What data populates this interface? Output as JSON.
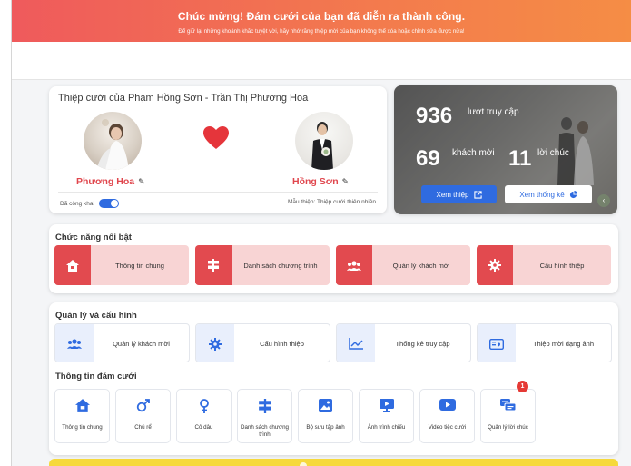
{
  "banner": {
    "title": "Chúc mừng! Đám cưới của bạn đã diễn ra thành công.",
    "subtitle": "Để giữ lại những khoảnh khắc tuyệt vời, hãy nhớ rằng thiệp mời của bạn không thể xóa hoặc chỉnh sửa được nữa!"
  },
  "profile": {
    "title": "Thiệp cưới của Phạm Hồng Sơn - Trần Thị Phương Hoa",
    "bride_name": "Phương Hoa",
    "groom_name": "Hồng Sơn",
    "published_label": "Đã công khai",
    "published": true,
    "template_label": "Mẫu thiệp: Thiệp cưới thiên nhiên"
  },
  "stats": {
    "visits": "936",
    "visits_label": "lượt truy cập",
    "guests": "69",
    "guests_label": "khách mời",
    "wishes": "11",
    "wishes_label": "lời chúc",
    "view_button": "Xem thiệp",
    "stats_button": "Xem thống kê"
  },
  "featured": {
    "title": "Chức năng nổi bật",
    "items": [
      {
        "label": "Thông tin chung",
        "icon": "house-icon"
      },
      {
        "label": "Danh sách chương trình",
        "icon": "signpost-icon"
      },
      {
        "label": "Quản lý khách mời",
        "icon": "users-icon"
      },
      {
        "label": "Cấu hình thiệp",
        "icon": "gear-icon"
      }
    ]
  },
  "manage": {
    "title": "Quản lý và cấu hình",
    "items": [
      {
        "label": "Quản lý khách mời",
        "icon": "users-icon"
      },
      {
        "label": "Cấu hình thiệp",
        "icon": "gear-icon"
      },
      {
        "label": "Thống kê truy cập",
        "icon": "chart-line-icon"
      },
      {
        "label": "Thiệp mời dạng ảnh",
        "icon": "image-card-icon"
      }
    ]
  },
  "wedding_info": {
    "title": "Thông tin đám cưới",
    "items": [
      {
        "label": "Thông tin chung",
        "icon": "house-icon"
      },
      {
        "label": "Chú rể",
        "icon": "male-icon"
      },
      {
        "label": "Cô dâu",
        "icon": "female-icon"
      },
      {
        "label": "Danh sách chương trình",
        "icon": "signpost-icon"
      },
      {
        "label": "Bộ sưu tập ảnh",
        "icon": "gallery-icon"
      },
      {
        "label": "Ảnh trình chiếu",
        "icon": "slideshow-icon"
      },
      {
        "label": "Video tiệc cưới",
        "icon": "video-icon"
      },
      {
        "label": "Quản lý lời chúc",
        "icon": "wishes-icon",
        "badge": "1"
      }
    ]
  },
  "colors": {
    "accent": "#2f6be0",
    "brand_red": "#e24a4f",
    "pink": "#f8d4d4",
    "banner_start": "#ef5a5c",
    "banner_end": "#f58d45"
  }
}
